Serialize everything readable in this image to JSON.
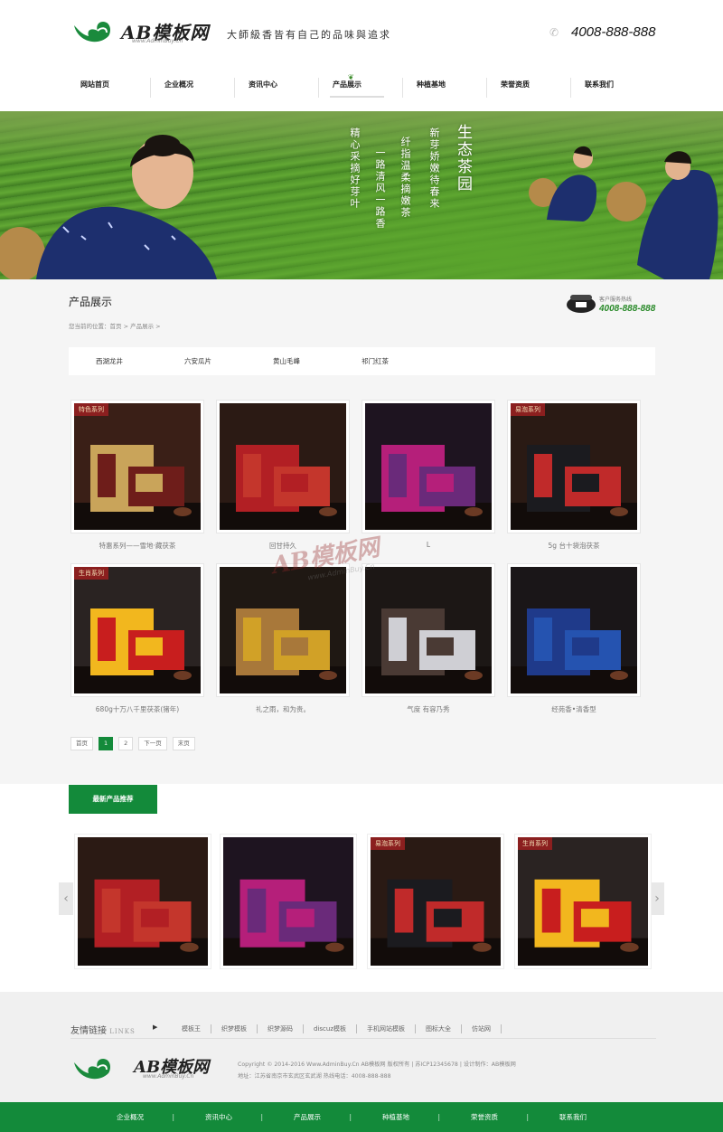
{
  "header": {
    "logo_text": "AB模板网",
    "logo_sub": "www.AdminBuy.Cn",
    "slogan": "大師級香皆有自己的品味與追求",
    "phone": "4008-888-888"
  },
  "nav": {
    "items": [
      {
        "label": "网站首页"
      },
      {
        "label": "企业概况"
      },
      {
        "label": "资讯中心"
      },
      {
        "label": "产品展示",
        "active": true
      },
      {
        "label": "种植基地"
      },
      {
        "label": "荣誉资质"
      },
      {
        "label": "联系我们"
      }
    ]
  },
  "banner": {
    "title": "生态茶园",
    "lines": [
      "新芽娇嫩待春来",
      "纤指温柔摘嫩茶",
      "一路清风一路香",
      "精心采摘好芽叶"
    ]
  },
  "page": {
    "title": "产品展示",
    "service_label": "客户服务热线",
    "service_phone": "4008-888-888",
    "breadcrumb": "您当前的位置：首页 > 产品展示 >"
  },
  "categories": [
    "西湖龙井",
    "六安瓜片",
    "黄山毛峰",
    "祁门红茶"
  ],
  "products": [
    {
      "caption": "特惠系列——雪地·藏茯茶",
      "tag": "特色系列",
      "theme": "gold"
    },
    {
      "caption": "回甘持久",
      "tag": "",
      "theme": "red"
    },
    {
      "caption": "L",
      "tag": "",
      "theme": "purple"
    },
    {
      "caption": "5g 台十袋泡茯茶",
      "tag": "易泡系列",
      "theme": "black"
    },
    {
      "caption": "680g十万八千里茯茶(猪年)",
      "tag": "生肖系列",
      "theme": "yellow"
    },
    {
      "caption": "礼之雨，和为贵。",
      "tag": "",
      "theme": "gift"
    },
    {
      "caption": "气度 有容乃秀",
      "tag": "",
      "theme": "silver"
    },
    {
      "caption": "经苑香•清香型",
      "tag": "",
      "theme": "blue"
    }
  ],
  "pager": [
    "首页",
    "1",
    "2",
    "下一页",
    "末页"
  ],
  "watermark": {
    "text": "AB模板网",
    "sub": "www.AdminBuy.Cn"
  },
  "recommend": {
    "tab_label": "最新产品推荐",
    "items": [
      {
        "tag": "",
        "theme": "red"
      },
      {
        "tag": "",
        "theme": "purple"
      },
      {
        "tag": "易泡系列",
        "theme": "black"
      },
      {
        "tag": "生肖系列",
        "theme": "yellow"
      }
    ]
  },
  "footer": {
    "links_title": "友情链接",
    "links_title_en": "LINKS",
    "links": [
      "模板王",
      "织梦模板",
      "织梦源码",
      "discuz模板",
      "手机网站模板",
      "图标大全",
      "仿站网"
    ],
    "logo_text": "AB模板网",
    "logo_sub": "www.AdminBuy.Cn",
    "copyright": "Copyright © 2014-2016 Www.AdminBuy.Cn AB模板网 版权所有 | 苏ICP12345678 | 设计制作：AB模板网",
    "address": "地址：江苏省南京市玄武区玄武湖 热线电话：4008-888-888",
    "bottom_nav": [
      "企业概况",
      "资讯中心",
      "产品展示",
      "种植基地",
      "荣誉资质",
      "联系我们"
    ]
  },
  "colors": {
    "brand_green": "#138a3a",
    "tag_red": "#8b1f1f",
    "phone_green": "#2a8a2a"
  }
}
